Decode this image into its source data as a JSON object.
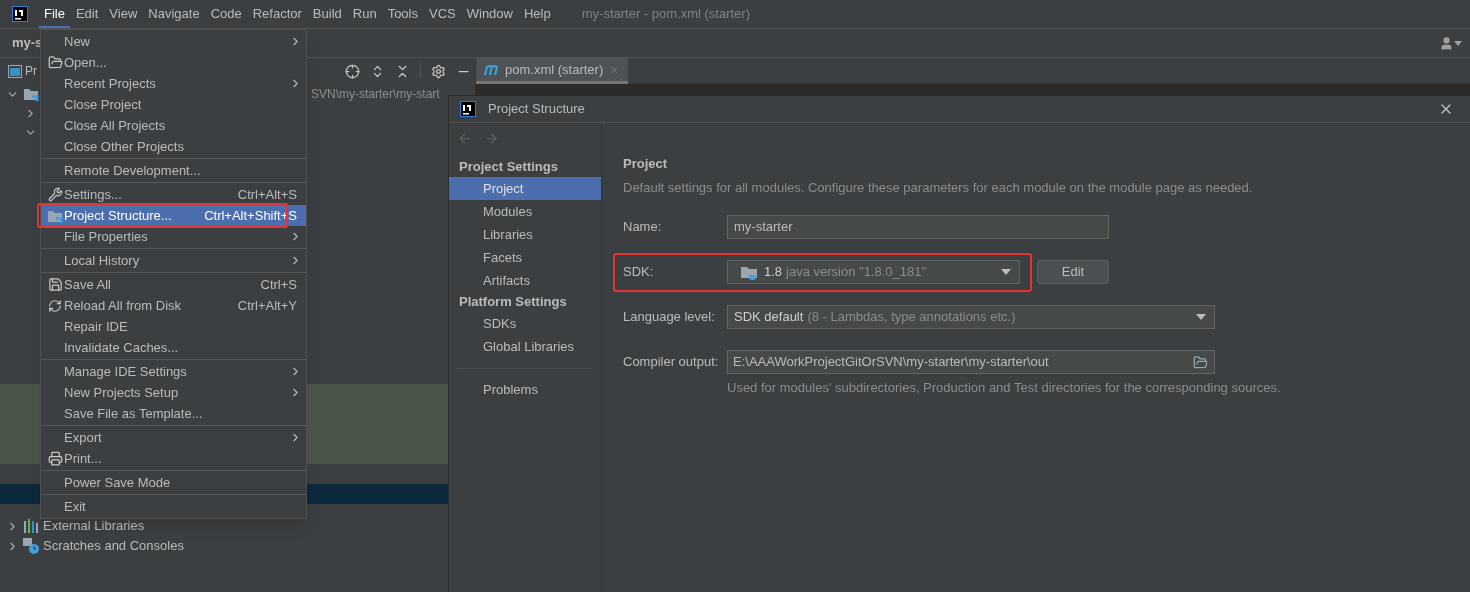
{
  "menubar": {
    "items": [
      {
        "label": "File",
        "selected": true
      },
      {
        "label": "Edit",
        "selected": false
      },
      {
        "label": "View",
        "selected": false
      },
      {
        "label": "Navigate",
        "selected": false
      },
      {
        "label": "Code",
        "selected": false
      },
      {
        "label": "Refactor",
        "selected": false
      },
      {
        "label": "Build",
        "selected": false
      },
      {
        "label": "Run",
        "selected": false
      },
      {
        "label": "Tools",
        "selected": false
      },
      {
        "label": "VCS",
        "selected": false
      },
      {
        "label": "Window",
        "selected": false
      },
      {
        "label": "Help",
        "selected": false
      }
    ],
    "window_title": "my-starter - pom.xml (starter)"
  },
  "navbar": {
    "project": "my-s"
  },
  "project_panel": {
    "tab": "Pr",
    "path": "SVN\\my-starter\\my-start",
    "tree": [
      {
        "label": "External Libraries",
        "expanded": false
      },
      {
        "label": "Scratches and Consoles",
        "expanded": false
      }
    ]
  },
  "editor": {
    "tabs": [
      {
        "label": "pom.xml (starter)",
        "selected": true
      }
    ]
  },
  "file_menu": {
    "items": [
      {
        "kind": "item",
        "label": "New",
        "submenu": true,
        "selected": false,
        "highlighted": false
      },
      {
        "kind": "item",
        "label": "Open...",
        "submenu": false,
        "selected": false,
        "highlighted": false
      },
      {
        "kind": "item",
        "label": "Recent Projects",
        "submenu": true,
        "selected": false,
        "highlighted": false
      },
      {
        "kind": "item",
        "label": "Close Project",
        "submenu": false,
        "selected": false,
        "highlighted": false
      },
      {
        "kind": "item",
        "label": "Close All Projects",
        "submenu": false,
        "selected": false,
        "highlighted": false
      },
      {
        "kind": "item",
        "label": "Close Other Projects",
        "submenu": false,
        "selected": false,
        "highlighted": false
      },
      {
        "kind": "separator"
      },
      {
        "kind": "item",
        "label": "Remote Development...",
        "submenu": false,
        "selected": false,
        "highlighted": false
      },
      {
        "kind": "separator"
      },
      {
        "kind": "item",
        "label": "Settings...",
        "shortcut": "Ctrl+Alt+S",
        "submenu": false,
        "selected": false,
        "highlighted": false
      },
      {
        "kind": "item",
        "label": "Project Structure...",
        "shortcut": "Ctrl+Alt+Shift+S",
        "submenu": false,
        "selected": true,
        "highlighted": true
      },
      {
        "kind": "item",
        "label": "File Properties",
        "submenu": true,
        "selected": false,
        "highlighted": false
      },
      {
        "kind": "separator"
      },
      {
        "kind": "item",
        "label": "Local History",
        "submenu": true,
        "selected": false,
        "highlighted": false
      },
      {
        "kind": "separator"
      },
      {
        "kind": "item",
        "label": "Save All",
        "shortcut": "Ctrl+S",
        "submenu": false,
        "selected": false,
        "highlighted": false
      },
      {
        "kind": "item",
        "label": "Reload All from Disk",
        "shortcut": "Ctrl+Alt+Y",
        "submenu": false,
        "selected": false,
        "highlighted": false
      },
      {
        "kind": "item",
        "label": "Repair IDE",
        "submenu": false,
        "selected": false,
        "highlighted": false
      },
      {
        "kind": "item",
        "label": "Invalidate Caches...",
        "submenu": false,
        "selected": false,
        "highlighted": false
      },
      {
        "kind": "separator"
      },
      {
        "kind": "item",
        "label": "Manage IDE Settings",
        "submenu": true,
        "selected": false,
        "highlighted": false
      },
      {
        "kind": "item",
        "label": "New Projects Setup",
        "submenu": true,
        "selected": false,
        "highlighted": false
      },
      {
        "kind": "item",
        "label": "Save File as Template...",
        "submenu": false,
        "selected": false,
        "highlighted": false
      },
      {
        "kind": "separator"
      },
      {
        "kind": "item",
        "label": "Export",
        "submenu": true,
        "selected": false,
        "highlighted": false
      },
      {
        "kind": "item",
        "label": "Print...",
        "submenu": false,
        "selected": false,
        "highlighted": false
      },
      {
        "kind": "separator"
      },
      {
        "kind": "item",
        "label": "Power Save Mode",
        "submenu": false,
        "selected": false,
        "highlighted": false
      },
      {
        "kind": "separator"
      },
      {
        "kind": "item",
        "label": "Exit",
        "submenu": false,
        "selected": false,
        "highlighted": false
      }
    ]
  },
  "dialog": {
    "title": "Project Structure",
    "sidebar": {
      "sections": [
        {
          "title": "Project Settings",
          "items": [
            {
              "label": "Project",
              "selected": true
            },
            {
              "label": "Modules",
              "selected": false
            },
            {
              "label": "Libraries",
              "selected": false
            },
            {
              "label": "Facets",
              "selected": false
            },
            {
              "label": "Artifacts",
              "selected": false
            }
          ]
        },
        {
          "title": "Platform Settings",
          "items": [
            {
              "label": "SDKs",
              "selected": false
            },
            {
              "label": "Global Libraries",
              "selected": false
            }
          ]
        },
        {
          "items": [
            {
              "label": "Problems",
              "selected": false
            }
          ]
        }
      ]
    },
    "heading": "Project",
    "description": "Default settings for all modules. Configure these parameters for each module on the module page as needed.",
    "fields": [
      {
        "kind": "text",
        "label": "Name:",
        "value": "my-starter",
        "highlighted": false
      },
      {
        "kind": "combo",
        "label": "SDK:",
        "value": "1.8",
        "detail": "java version \"1.8.0_181\"",
        "button": "Edit",
        "highlighted": true
      },
      {
        "kind": "combo",
        "label": "Language level:",
        "value": "SDK default",
        "detail": "(8 - Lambdas, type annotations etc.)",
        "highlighted": false
      },
      {
        "kind": "path",
        "label": "Compiler output:",
        "value": "E:\\AAAWorkProjectGitOrSVN\\my-starter\\my-starter\\out",
        "hint": "Used for modules' subdirectories, Production and Test directories for the corresponding sources.",
        "highlighted": false
      }
    ]
  }
}
